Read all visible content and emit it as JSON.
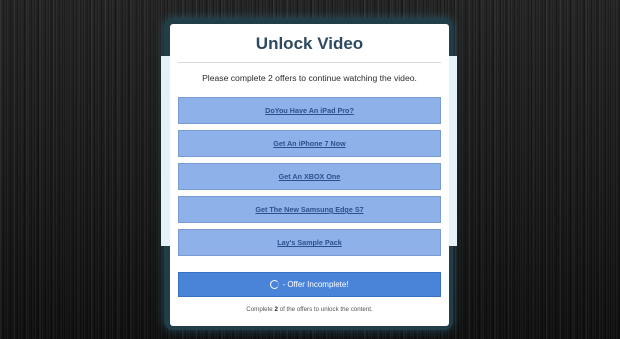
{
  "modal": {
    "title": "Unlock Video",
    "instructions": "Please complete 2 offers to continue watching the video."
  },
  "offers": [
    {
      "label": "DoYou Have An iPad Pro?"
    },
    {
      "label": "Get An iPhone 7 Now"
    },
    {
      "label": "Get An XBOX One"
    },
    {
      "label": "Get The New Samsung Edge S7"
    },
    {
      "label": "Lay's Sample Pack"
    }
  ],
  "status": {
    "icon": "spinner-icon",
    "text": " - Offer Incomplete!"
  },
  "footer": {
    "prefix": "Complete ",
    "count": "2",
    "suffix": " of the offers to unlock the content."
  },
  "colors": {
    "title": "#2e4a60",
    "offer_bg": "#8fb1ea",
    "offer_text": "#2d4f8c",
    "status_bg": "#4a84d8",
    "frame": "#213d47"
  }
}
